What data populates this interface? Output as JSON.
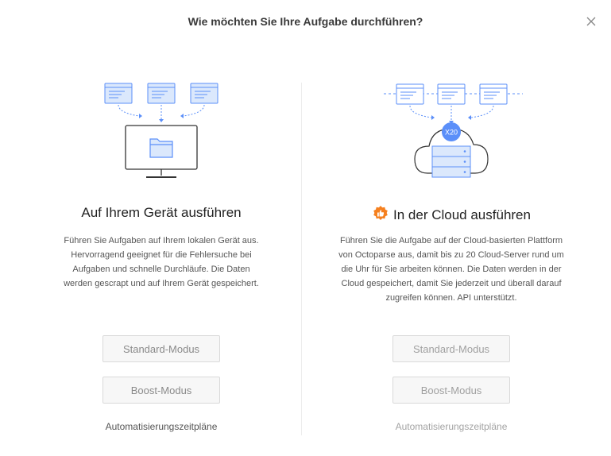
{
  "dialog": {
    "title": "Wie möchten Sie Ihre Aufgabe durchführen?",
    "close_icon": "close-icon"
  },
  "local": {
    "title": "Auf Ihrem Gerät ausführen",
    "description": "Führen Sie Aufgaben auf Ihrem lokalen Gerät aus. Hervorragend geeignet für die Fehlersuche bei Aufgaben und schnelle Durchläufe. Die Daten werden gescrapt und auf Ihrem Gerät gespeichert.",
    "standard_button": "Standard-Modus",
    "boost_button": "Boost-Modus",
    "schedule_link": "Automatisierungszeitpläne"
  },
  "cloud": {
    "title": "In der Cloud ausführen",
    "badge_icon": "thumbs-up-icon",
    "badge_color": "#f5801f",
    "multiplier": "X20",
    "description": "Führen Sie die Aufgabe auf der Cloud-basierten Plattform von Octoparse aus, damit bis zu 20 Cloud-Server rund um die Uhr für Sie arbeiten können. Die Daten werden in der Cloud gespeichert, damit Sie jederzeit und überall darauf zugreifen können. API unterstützt.",
    "standard_button": "Standard-Modus",
    "boost_button": "Boost-Modus",
    "schedule_link": "Automatisierungszeitpläne"
  },
  "colors": {
    "accent_blue": "#5b8ff9",
    "light_blue": "#dbe8fc"
  }
}
